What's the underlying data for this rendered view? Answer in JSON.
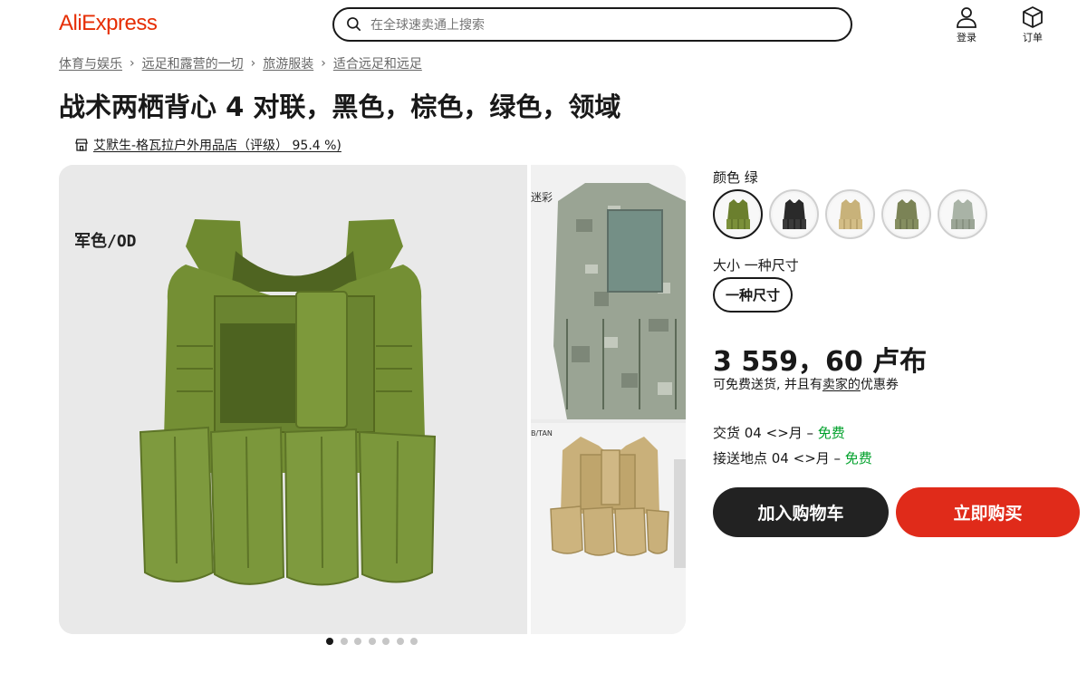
{
  "header": {
    "logo": "AliExpress",
    "search_placeholder": "在全球速卖通上搜索",
    "login_label": "登录",
    "orders_label": "订单"
  },
  "breadcrumb": [
    "体育与娱乐",
    "远足和露营的一切",
    "旅游服装",
    "适合远足和远足"
  ],
  "product": {
    "title": "战术两栖背心 4 对联，黑色，棕色，绿色，领域",
    "store": "艾默生-格瓦拉户外用品店（评级） 95.4 %)"
  },
  "gallery": {
    "main_label": "军色/OD",
    "side_top_label": "迷彩",
    "side_bottom_label": "B/TAN",
    "dot_count": 7,
    "active_dot": 1
  },
  "options": {
    "color_label": "颜色 绿",
    "colors": [
      {
        "name": "green",
        "hex": "#6b7f2e"
      },
      {
        "name": "black",
        "hex": "#2a2a2a"
      },
      {
        "name": "tan",
        "hex": "#c8b27a"
      },
      {
        "name": "olive",
        "hex": "#7b8356"
      },
      {
        "name": "acu-camo",
        "hex": "#a9b3a6"
      }
    ],
    "selected_color": 0,
    "size_label": "大小 一种尺寸",
    "size_value": "一种尺寸"
  },
  "pricing": {
    "price": "3 559，60 卢布",
    "shipping_pre": "可免费送货, 并且有",
    "shipping_link": "卖家的",
    "shipping_post": "优惠券"
  },
  "delivery": {
    "line1_prefix": "交货 04 <>月 – ",
    "line1_free": "免费",
    "line2_prefix": "接送地点 04 <>月 – ",
    "line2_free": "免费"
  },
  "actions": {
    "cart_label": "加入购物车",
    "buy_label": "立即购买"
  },
  "colors": {
    "brand": "#e62e04",
    "buy_button": "#e02b1a",
    "cart_button": "#222222",
    "free_text": "#00a12b"
  }
}
